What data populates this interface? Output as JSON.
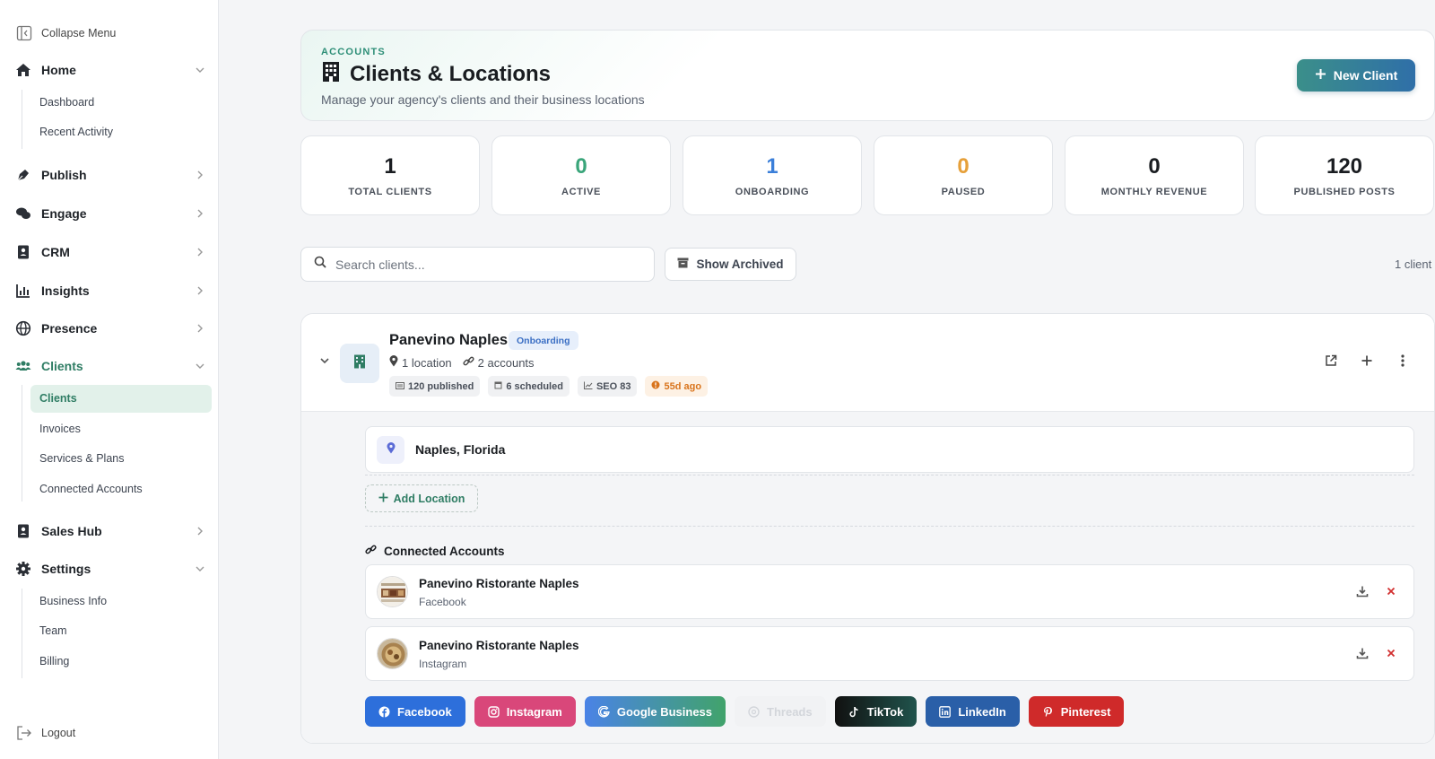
{
  "sidebar": {
    "collapse_label": "Collapse Menu",
    "home": "Home",
    "home_items": [
      "Dashboard",
      "Recent Activity"
    ],
    "publish": "Publish",
    "engage": "Engage",
    "crm": "CRM",
    "insights": "Insights",
    "presence": "Presence",
    "clients": "Clients",
    "clients_items": [
      "Clients",
      "Invoices",
      "Services & Plans",
      "Connected Accounts"
    ],
    "sales_hub": "Sales Hub",
    "settings": "Settings",
    "settings_items": [
      "Business Info",
      "Team",
      "Billing"
    ],
    "logout": "Logout"
  },
  "header": {
    "eyebrow": "ACCOUNTS",
    "title": "Clients & Locations",
    "subtitle": "Manage your agency's clients and their business locations",
    "new_client": "New Client"
  },
  "stats": [
    {
      "value": "1",
      "label": "TOTAL CLIENTS",
      "color": "#1a1d21"
    },
    {
      "value": "0",
      "label": "ACTIVE",
      "color": "#3aa57a"
    },
    {
      "value": "1",
      "label": "ONBOARDING",
      "color": "#3b7fd9"
    },
    {
      "value": "0",
      "label": "PAUSED",
      "color": "#e6a03a"
    },
    {
      "value": "0",
      "label": "MONTHLY REVENUE",
      "color": "#1a1d21"
    },
    {
      "value": "120",
      "label": "PUBLISHED POSTS",
      "color": "#1a1d21"
    }
  ],
  "search": {
    "placeholder": "Search clients..."
  },
  "show_archived": "Show Archived",
  "client_count": "1 client",
  "client": {
    "name": "Panevino Naples",
    "status": "Onboarding",
    "locations": "1 location",
    "accounts": "2 accounts",
    "published": "120 published",
    "scheduled": "6 scheduled",
    "seo": "SEO 83",
    "last_active": "55d ago",
    "location_name": "Naples, Florida",
    "add_location": "Add Location",
    "connected_title": "Connected Accounts",
    "connected": [
      {
        "name": "Panevino Ristorante Naples",
        "platform": "Facebook"
      },
      {
        "name": "Panevino Ristorante Naples",
        "platform": "Instagram"
      }
    ]
  },
  "social_buttons": [
    {
      "label": "Facebook",
      "color": "#2d6fdb"
    },
    {
      "label": "Instagram",
      "color": "#d9477a"
    },
    {
      "label": "Google Business",
      "color": "linear-gradient(90deg,#4a83e6,#41a36b)"
    },
    {
      "label": "Threads",
      "color": "#f1f2f4"
    },
    {
      "label": "TikTok",
      "color": "linear-gradient(90deg,#111,#20534c)"
    },
    {
      "label": "LinkedIn",
      "color": "#2a5fa8"
    },
    {
      "label": "Pinterest",
      "color": "#cf2a2a"
    }
  ]
}
